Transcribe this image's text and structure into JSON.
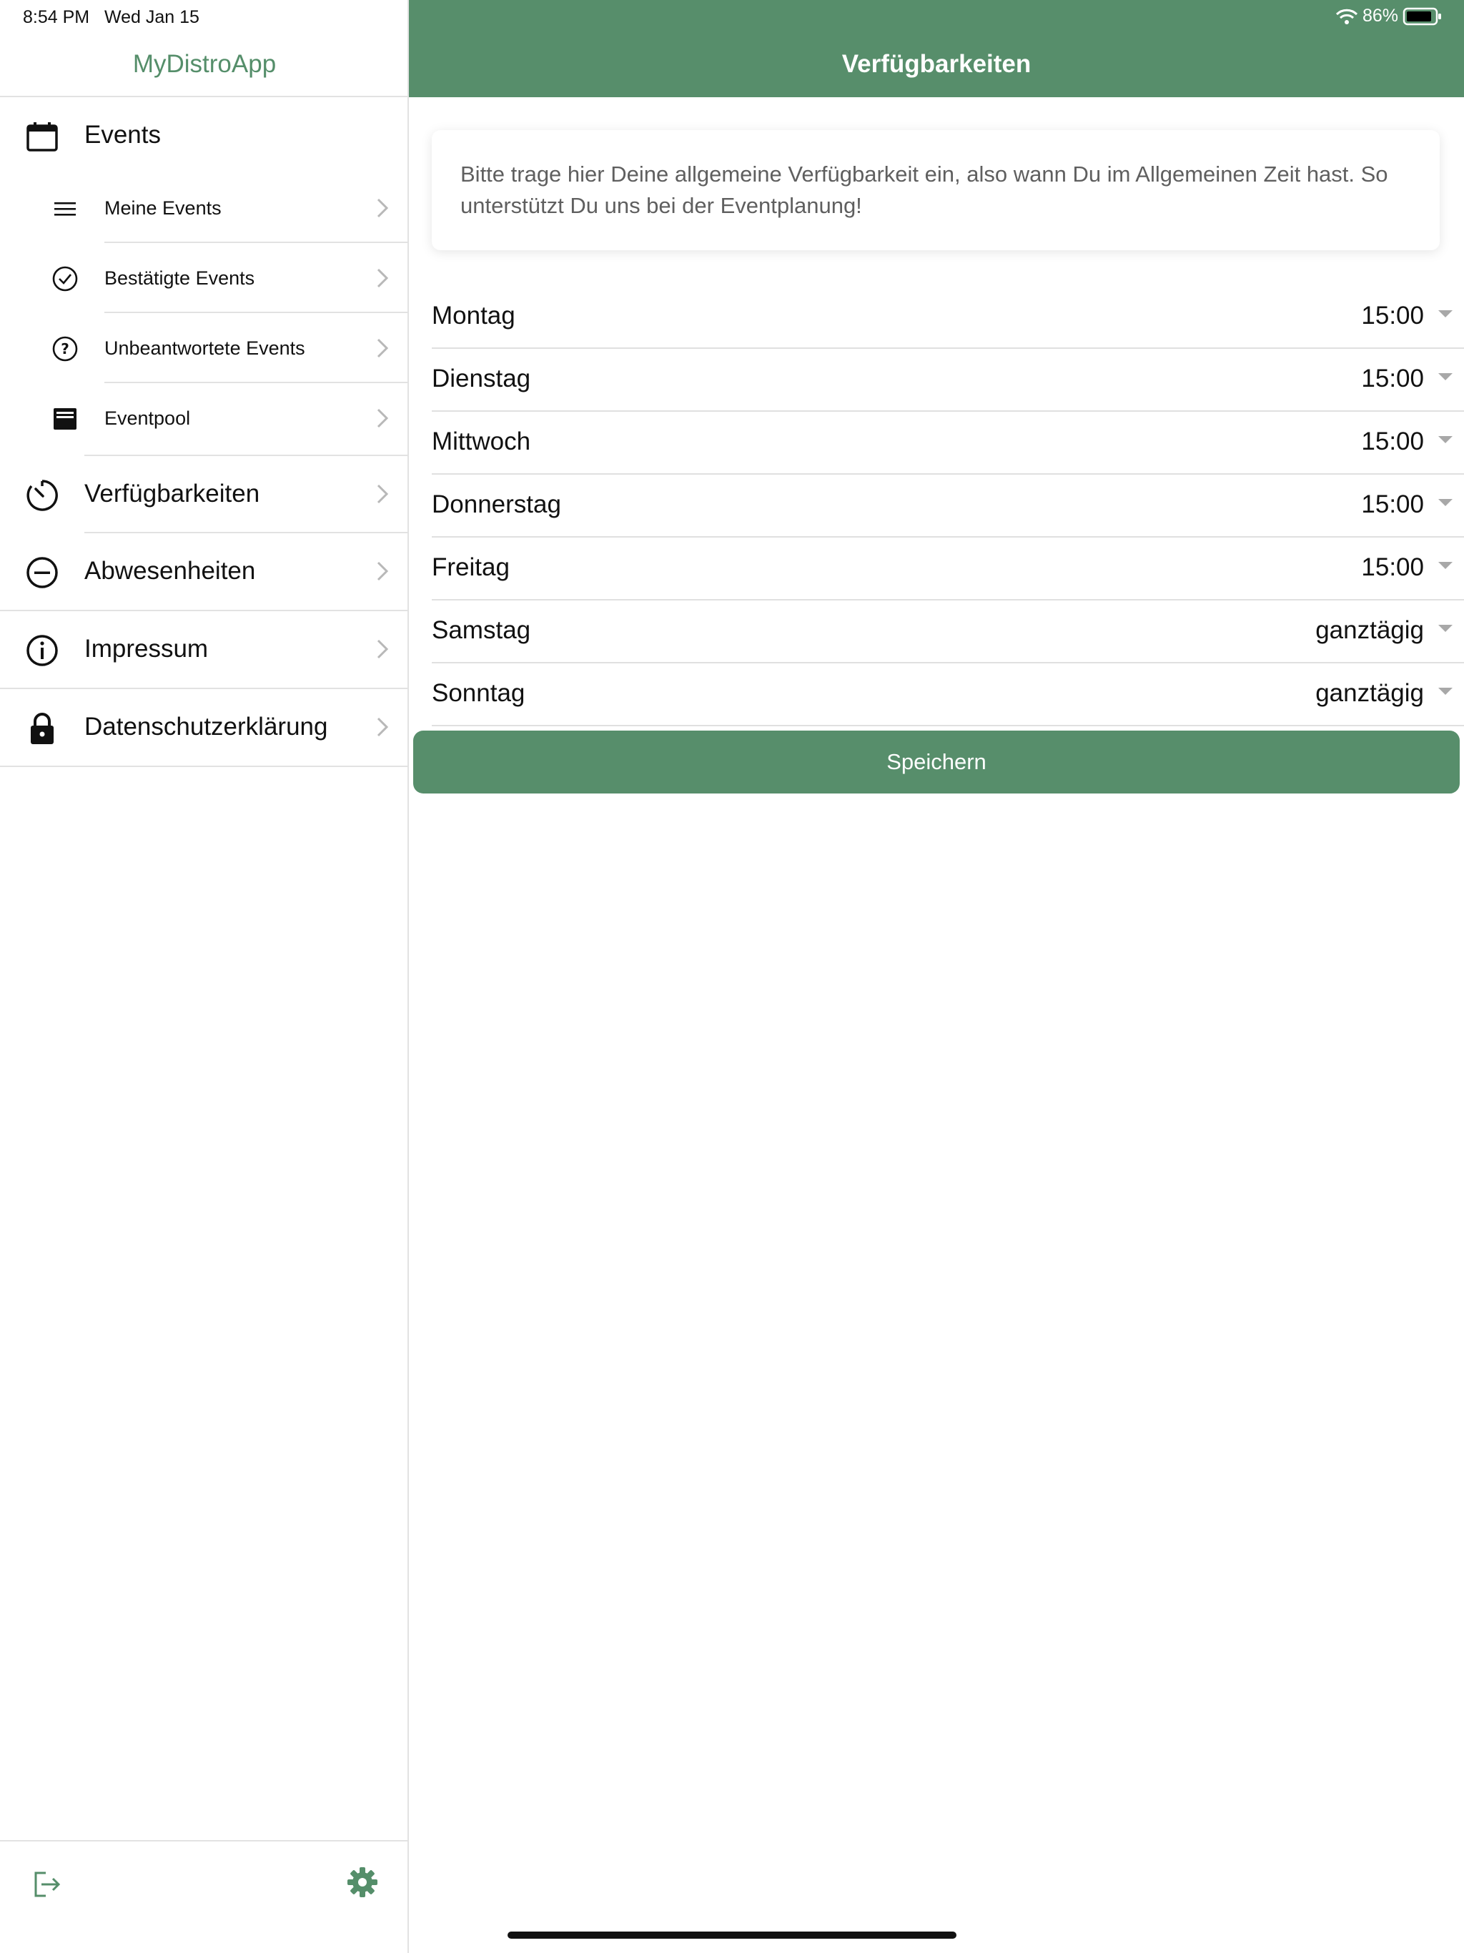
{
  "status_bar": {
    "time": "8:54 PM",
    "date": "Wed Jan 15",
    "battery": "86%"
  },
  "sidebar": {
    "title": "MyDistroApp",
    "items": [
      {
        "label": "Events",
        "icon": "calendar-icon",
        "level": "main"
      },
      {
        "label": "Meine Events",
        "icon": "list-icon",
        "level": "sub"
      },
      {
        "label": "Bestätigte Events",
        "icon": "check-circle-icon",
        "level": "sub"
      },
      {
        "label": "Unbeantwortete Events",
        "icon": "question-circle-icon",
        "level": "sub"
      },
      {
        "label": "Eventpool",
        "icon": "inbox-icon",
        "level": "sub"
      },
      {
        "label": "Verfügbarkeiten",
        "icon": "timer-icon",
        "level": "main"
      },
      {
        "label": "Abwesenheiten",
        "icon": "minus-circle-icon",
        "level": "main"
      },
      {
        "label": "Impressum",
        "icon": "info-circle-icon",
        "level": "main"
      },
      {
        "label": "Datenschutzerklärung",
        "icon": "lock-icon",
        "level": "main"
      }
    ],
    "footer": {
      "logout_icon": "logout-icon",
      "settings_icon": "gear-icon"
    }
  },
  "main": {
    "header_title": "Verfügbarkeiten",
    "info_text": "Bitte trage hier Deine allgemeine Verfügbarkeit ein, also wann Du im Allgemeinen Zeit hast. So unterstützt Du uns bei der Eventplanung!",
    "days": [
      {
        "day": "Montag",
        "value": "15:00"
      },
      {
        "day": "Dienstag",
        "value": "15:00"
      },
      {
        "day": "Mittwoch",
        "value": "15:00"
      },
      {
        "day": "Donnerstag",
        "value": "15:00"
      },
      {
        "day": "Freitag",
        "value": "15:00"
      },
      {
        "day": "Samstag",
        "value": "ganztägig"
      },
      {
        "day": "Sonntag",
        "value": "ganztägig"
      }
    ],
    "save_label": "Speichern"
  },
  "colors": {
    "accent": "#578e6b",
    "brand_text": "#558e6a",
    "divider": "#e2e2e2"
  }
}
